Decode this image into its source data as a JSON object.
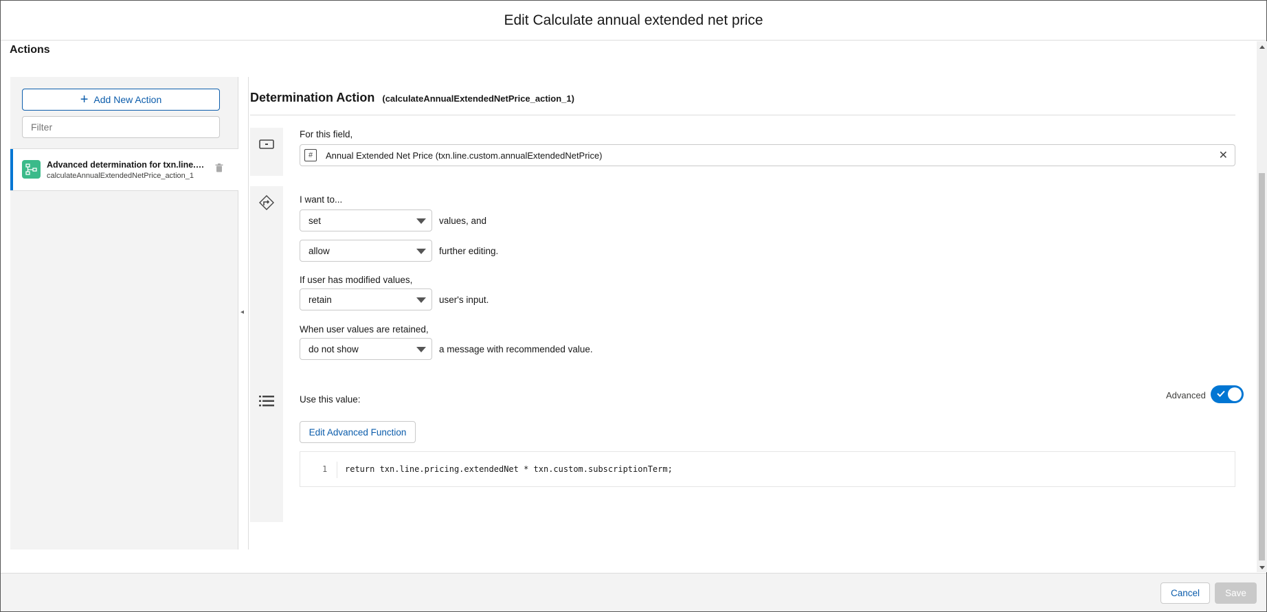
{
  "modal": {
    "title": "Edit Calculate annual extended net price"
  },
  "actions_panel": {
    "title": "Actions",
    "add_button_label": "Add New Action",
    "filter_placeholder": "Filter",
    "items": [
      {
        "title": "Advanced determination for txn.line.c...",
        "subtitle": "calculateAnnualExtendedNetPrice_action_1"
      }
    ]
  },
  "determination": {
    "title": "Determination Action",
    "api_name": "(calculateAnnualExtendedNetPrice_action_1)",
    "field_section": {
      "label": "For this field,",
      "value": "Annual Extended Net Price (txn.line.custom.annualExtendedNetPrice)",
      "type_icon": "#"
    },
    "behavior_section": {
      "i_want_label": "I want to...",
      "mode_value": "set",
      "mode_suffix": "values, and",
      "editing_value": "allow",
      "editing_suffix": "further editing.",
      "modified_label": "If user has modified values,",
      "modified_value": "retain",
      "modified_suffix": "user's input.",
      "retained_label": "When user values are retained,",
      "retained_value": "do not show",
      "retained_suffix": "a message with recommended value."
    },
    "value_section": {
      "label": "Use this value:",
      "advanced_label": "Advanced",
      "advanced_on": true,
      "edit_button_label": "Edit Advanced Function",
      "code_lines": [
        {
          "number": "1",
          "text": "return txn.line.pricing.extendedNet * txn.custom.subscriptionTerm;"
        }
      ]
    }
  },
  "footer": {
    "cancel_label": "Cancel",
    "save_label": "Save"
  },
  "colors": {
    "brand": "#0176d3",
    "link": "#0b5cab",
    "action_icon_bg": "#3bba8a",
    "disabled": "#c9c9c9"
  }
}
